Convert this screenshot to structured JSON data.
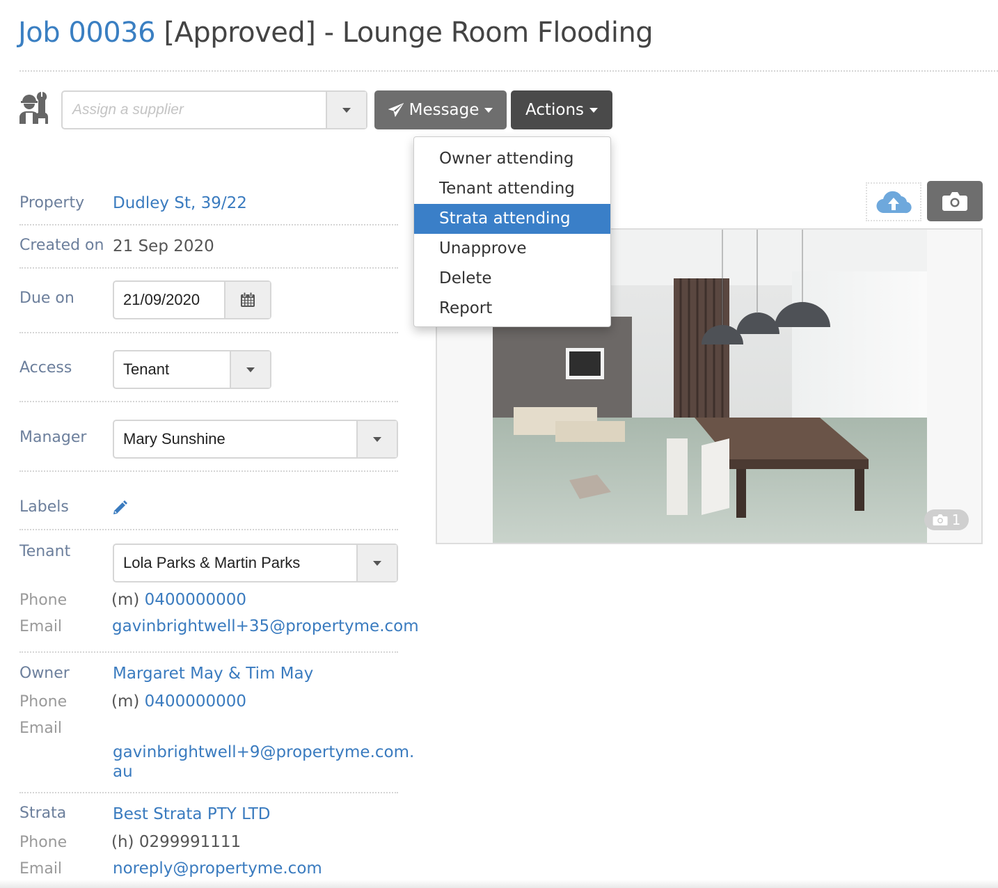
{
  "header": {
    "job_number": "Job 00036",
    "title_rest": "[Approved] - Lounge Room Flooding"
  },
  "toolbar": {
    "supplier_placeholder": "Assign a supplier",
    "message_label": "Message",
    "actions_label": "Actions"
  },
  "actions_menu": {
    "items": [
      {
        "label": "Owner attending",
        "active": false
      },
      {
        "label": "Tenant attending",
        "active": false
      },
      {
        "label": "Strata attending",
        "active": true
      },
      {
        "label": "Unapprove",
        "active": false
      },
      {
        "label": "Delete",
        "active": false
      },
      {
        "label": "Report",
        "active": false
      }
    ]
  },
  "details": {
    "property": {
      "label": "Property",
      "value": "Dudley St, 39/22"
    },
    "created_on": {
      "label": "Created on",
      "value": "21 Sep 2020"
    },
    "due_on": {
      "label": "Due on",
      "value": "21/09/2020"
    },
    "access": {
      "label": "Access",
      "value": "Tenant"
    },
    "manager": {
      "label": "Manager",
      "value": "Mary Sunshine"
    },
    "labels": {
      "label": "Labels"
    },
    "tenant": {
      "label": "Tenant",
      "value": "Lola Parks & Martin Parks",
      "phone_label": "Phone",
      "phone_prefix": "(m)",
      "phone": "0400000000",
      "email_label": "Email",
      "email": "gavinbrightwell+35@propertyme.com"
    },
    "owner": {
      "label": "Owner",
      "value": "Margaret May & Tim May",
      "phone_label": "Phone",
      "phone_prefix": "(m)",
      "phone": "0400000000",
      "email_label": "Email",
      "email_line1": "gavinbrightwell+9@propertyme.com.",
      "email_line2": "au"
    },
    "strata": {
      "label": "Strata",
      "value": "Best Strata PTY LTD",
      "phone_label": "Phone",
      "phone": "(h) 0299991111",
      "email_label": "Email",
      "email": "noreply@propertyme.com"
    }
  },
  "photos": {
    "count": "1",
    "image_alt": "Flooded lounge room"
  },
  "colors": {
    "link": "#3a7bbf",
    "menu_active": "#3a7fc8",
    "message_button": "#6e6e6e",
    "actions_button": "#4a4a4a",
    "label": "#6c7f9c"
  }
}
